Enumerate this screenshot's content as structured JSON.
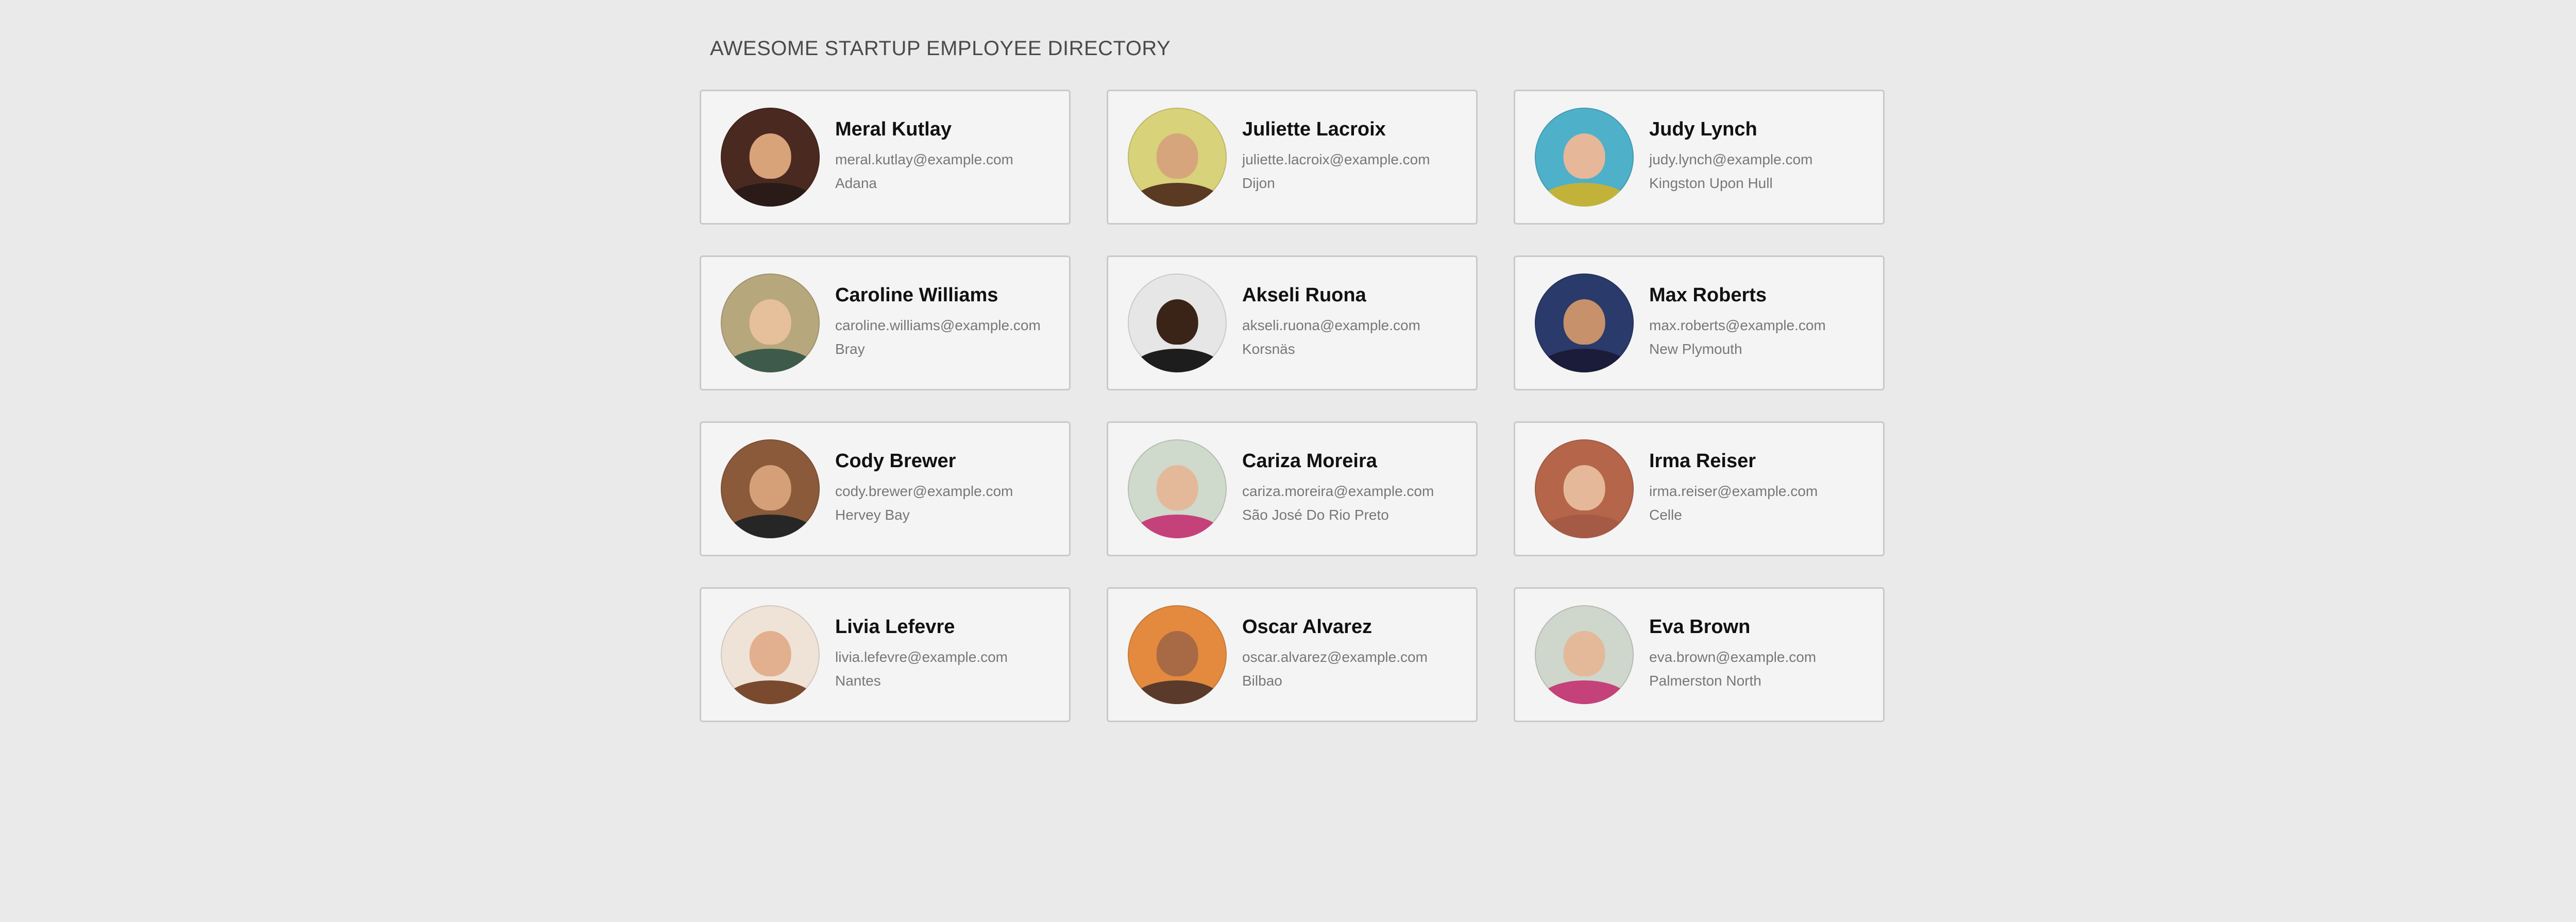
{
  "header": {
    "title": "AWESOME STARTUP EMPLOYEE DIRECTORY"
  },
  "employees": [
    {
      "name": "Meral Kutlay",
      "email": "meral.kutlay@example.com",
      "city": "Adana",
      "avatar_bg": "#4a2a20",
      "avatar_face": "#d9a37a",
      "avatar_body": "#2a1b18"
    },
    {
      "name": "Juliette Lacroix",
      "email": "juliette.lacroix@example.com",
      "city": "Dijon",
      "avatar_bg": "#d8d27a",
      "avatar_face": "#d7a57b",
      "avatar_body": "#5a3a22"
    },
    {
      "name": "Judy Lynch",
      "email": "judy.lynch@example.com",
      "city": "Kingston Upon Hull",
      "avatar_bg": "#4fb0c9",
      "avatar_face": "#e7b79a",
      "avatar_body": "#c3b23a"
    },
    {
      "name": "Caroline Williams",
      "email": "caroline.williams@example.com",
      "city": "Bray",
      "avatar_bg": "#b7a77c",
      "avatar_face": "#e6c09a",
      "avatar_body": "#3e5a4a"
    },
    {
      "name": "Akseli Ruona",
      "email": "akseli.ruona@example.com",
      "city": "Korsnäs",
      "avatar_bg": "#e6e6e6",
      "avatar_face": "#3a2418",
      "avatar_body": "#1d1d1d"
    },
    {
      "name": "Max Roberts",
      "email": "max.roberts@example.com",
      "city": "New Plymouth",
      "avatar_bg": "#2a3a6a",
      "avatar_face": "#c7916b",
      "avatar_body": "#1b1b3a"
    },
    {
      "name": "Cody Brewer",
      "email": "cody.brewer@example.com",
      "city": "Hervey Bay",
      "avatar_bg": "#8a5a3a",
      "avatar_face": "#d5a078",
      "avatar_body": "#262626"
    },
    {
      "name": "Cariza Moreira",
      "email": "cariza.moreira@example.com",
      "city": "São José Do Rio Preto",
      "avatar_bg": "#cfd9cc",
      "avatar_face": "#e3b99a",
      "avatar_body": "#c5417a"
    },
    {
      "name": "Irma Reiser",
      "email": "irma.reiser@example.com",
      "city": "Celle",
      "avatar_bg": "#b5664a",
      "avatar_face": "#e6b89a",
      "avatar_body": "#a55a46"
    },
    {
      "name": "Livia Lefevre",
      "email": "livia.lefevre@example.com",
      "city": "Nantes",
      "avatar_bg": "#efe3d8",
      "avatar_face": "#e2b08e",
      "avatar_body": "#7a4a2e"
    },
    {
      "name": "Oscar Alvarez",
      "email": "oscar.alvarez@example.com",
      "city": "Bilbao",
      "avatar_bg": "#e38a3f",
      "avatar_face": "#a86a44",
      "avatar_body": "#5a3a2a"
    },
    {
      "name": "Eva Brown",
      "email": "eva.brown@example.com",
      "city": "Palmerston North",
      "avatar_bg": "#cfd6cc",
      "avatar_face": "#e3b99a",
      "avatar_body": "#c5417a"
    }
  ]
}
